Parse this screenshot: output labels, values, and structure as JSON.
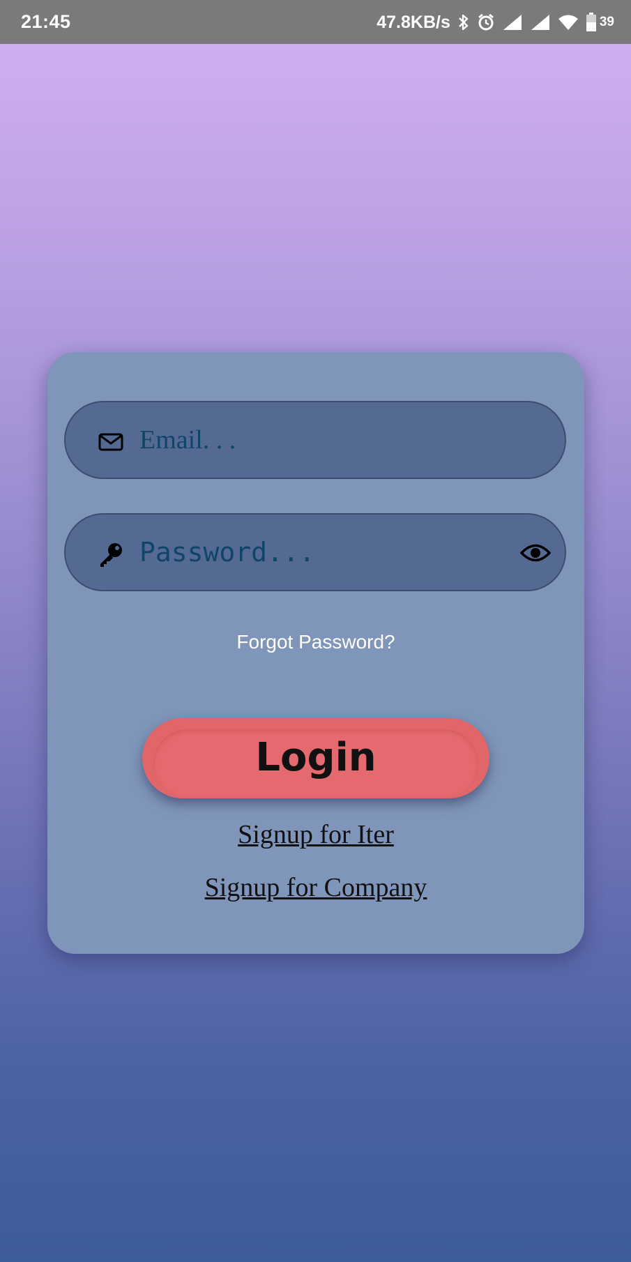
{
  "status_bar": {
    "time": "21:45",
    "net_speed": "47.8KB/s",
    "battery_percent": "39",
    "icons": [
      "bluetooth-icon",
      "alarm-icon",
      "signal-icon",
      "signal-icon",
      "wifi-icon",
      "battery-icon"
    ]
  },
  "login_form": {
    "email": {
      "value": "",
      "placeholder": "Email. . .",
      "icon": "envelope-icon"
    },
    "password": {
      "value": "",
      "placeholder": "Password...",
      "icon": "key-icon",
      "toggle_icon": "eye-icon"
    },
    "forgot_password": "Forgot Password?",
    "login_label": "Login",
    "signup_iter": "Signup for Iter",
    "signup_company": "Signup for Company"
  },
  "colors": {
    "card": "#7f95ba",
    "field": "#556a93",
    "login_button": "#e0666a",
    "placeholder_text": "#0f4566"
  }
}
